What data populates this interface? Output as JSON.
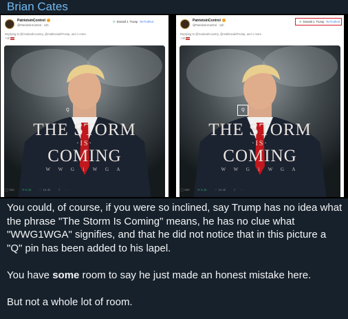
{
  "message": {
    "sender": "Brian Cates",
    "paragraphs": [
      "You could, of course, if you were so inclined, say Trump has no idea what the phrase \"The Storm Is Coming\" means, he has no clue what \"WWG1WGA\" signifies, and that he did not notice that in this picture a \"Q\" pin has been added to his lapel.",
      "You have",
      "some",
      "room to say he just made an honest mistake here.",
      "But not a whole lot of room."
    ]
  },
  "post": {
    "account_name": "PatriotsinControl",
    "handle": "@PatriotsinControl · 11h",
    "retruthed_by": "Donald J. Trump",
    "retruthed_label": "ReTruthed",
    "replying_to": "Replying to @GodandCountry, @realDonaldTrump, and 1 more",
    "extra_count": "+40",
    "poster": {
      "pin_letter": "Q",
      "line1": "THE STORM",
      "line2": "·IS·",
      "line3": "COMING",
      "tagline": "W W G 1 W G A"
    },
    "actions": {
      "replies": "656",
      "retruths": "5.1k",
      "likes": "15.4k",
      "share": "⇧",
      "more": "···"
    }
  },
  "colors": {
    "background": "#17212b",
    "sender": "#71baf2",
    "highlight_box": "#d11f2a"
  }
}
